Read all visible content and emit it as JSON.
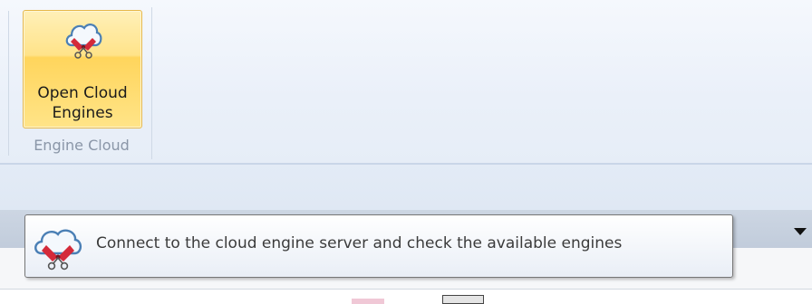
{
  "ribbon": {
    "groups": [
      {
        "label": "Engine Cloud",
        "buttons": [
          {
            "label_line1": "Open Cloud",
            "label_line2": "Engines",
            "icon": "cloud-engine-icon",
            "state": "hover"
          }
        ]
      }
    ]
  },
  "tooltip": {
    "icon": "cloud-engine-icon",
    "text": "Connect to the cloud engine server and check the available engines"
  },
  "colors": {
    "button_hover": "#ffd55c",
    "ribbon_bg": "#eaf0f9",
    "tabbar_bg": "#c8d2e0",
    "engine_red": "#d42a3a"
  }
}
